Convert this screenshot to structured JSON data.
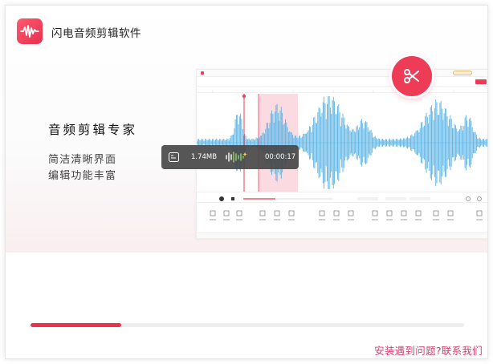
{
  "app": {
    "title": "闪电音频剪辑软件",
    "icon": "audio-wave-icon",
    "accent_color": "#ee3b56"
  },
  "hero": {
    "headline": "音频剪辑专家",
    "sublines": [
      "简洁清晰界面",
      "编辑功能丰富"
    ]
  },
  "preview": {
    "description": "screenshot of editor interface",
    "cut_badge_icon": "scissors-icon",
    "info_pill": {
      "file_icon": "audio-file-icon",
      "size": "1.74MB",
      "wave_icon": "waveform-icon",
      "duration": "00:00:17"
    }
  },
  "install": {
    "progress": 0.21,
    "help_link": "安装遇到问题?联系我们"
  }
}
